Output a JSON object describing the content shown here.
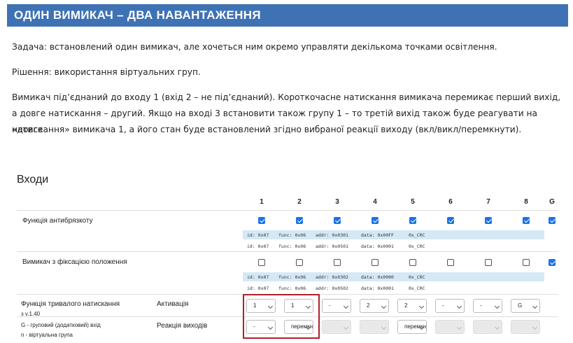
{
  "header": {
    "title": "ОДИН ВИМИКАЧ – ДВА НАВАНТАЖЕННЯ"
  },
  "text": {
    "task": "Задача: встановлений один вимикач, але хочеться ним окремо управляти декількома точками освітлення.",
    "solution": "Рішення: використання віртуальних груп.",
    "desc_line1": "Вимикач під’єднаний до входу 1 (вхід 2 – не під’єднаний). Короткочасне натискання вимикача перемикає перший вихід,",
    "desc_line2": "а довге натискання – другий. Якщо на вході 3 встановити також групу 1 – то третій вихід також буде реагувати на «довге",
    "desc_line3": "натискання» вимикача 1, а його стан буде встановлений згідно вибраної реакції виходу (вкл/викл/перемкнути)."
  },
  "inputs": {
    "title": "Входи",
    "columns": [
      "1",
      "2",
      "3",
      "4",
      "5",
      "6",
      "7",
      "8",
      "G"
    ],
    "debounce": {
      "label": "Функція антибрязкоту",
      "checked": [
        true,
        true,
        true,
        true,
        true,
        true,
        true,
        true,
        true
      ],
      "info": [
        [
          "id: 0x07",
          "func: 0x06",
          "addr: 0x0301",
          "data: 0x00FF",
          "0x_CRC"
        ],
        [
          "id: 0x07",
          "func: 0x06",
          "addr: 0x0501",
          "data: 0x0001",
          "0x_CRC"
        ]
      ]
    },
    "latching": {
      "label": "Вимикач з фіксацією положення",
      "checked": [
        false,
        false,
        false,
        false,
        false,
        false,
        false,
        false,
        true
      ],
      "info": [
        [
          "id: 0x07",
          "func: 0x06",
          "addr: 0x0302",
          "data: 0x0000",
          "0x_CRC"
        ],
        [
          "id: 0x07",
          "func: 0x06",
          "addr: 0x0502",
          "data: 0x0001",
          "0x_CRC"
        ]
      ]
    },
    "longpress": {
      "label": "Функція тривалого натискання",
      "version": "з v.1.40",
      "legend_g": "G - груповий (додатковий) вхід",
      "legend_n": "n - віртуальна група",
      "activation_label": "Активація",
      "reaction_label": "Реакція виходів",
      "activation": [
        "1",
        "1",
        "-",
        "2",
        "2",
        "-",
        "-",
        "G"
      ],
      "reaction": [
        "-",
        "перемкнути",
        "",
        "",
        "перемкнути",
        "",
        "",
        ""
      ],
      "reaction_disabled": [
        false,
        false,
        true,
        true,
        false,
        true,
        true,
        true
      ]
    }
  }
}
